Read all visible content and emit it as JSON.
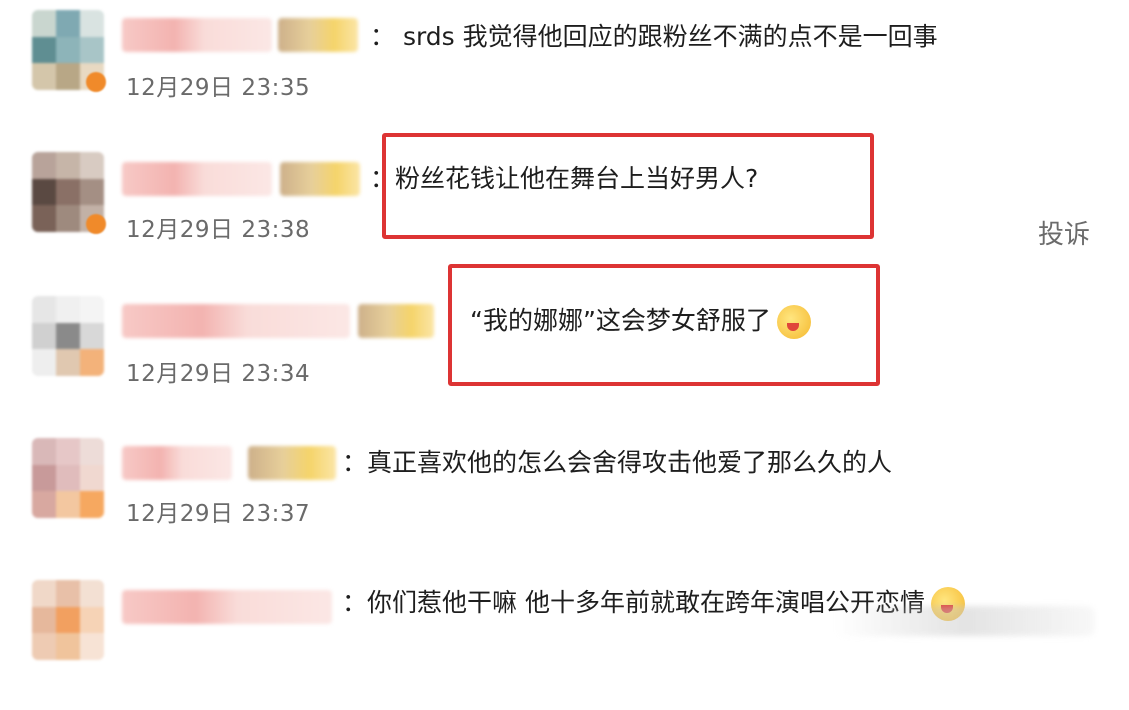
{
  "comments": [
    {
      "text": "：  srds 我觉得他回应的跟粉丝不满的点不是一回事",
      "time": "12月29日 23:35"
    },
    {
      "text": "：粉丝花钱让他在舞台上当好男人?",
      "time": "12月29日 23:38"
    },
    {
      "text": "“我的娜娜”这会梦女舒服了",
      "time": "12月29日 23:34",
      "emoji": "grinning-tongue-emoji"
    },
    {
      "text": "：真正喜欢他的怎么会舍得攻击他爱了那么久的人",
      "time": "12月29日 23:37"
    },
    {
      "text": "：你们惹他干嘛 他十多年前就敢在跨年演唱公开恋情",
      "time": "",
      "emoji": "laughing-crying-emoji"
    }
  ],
  "report_label": "投诉",
  "colors": {
    "highlight_border": "#dd3434",
    "time_text": "#6a6a6a",
    "report_text": "#6b6b6b"
  }
}
